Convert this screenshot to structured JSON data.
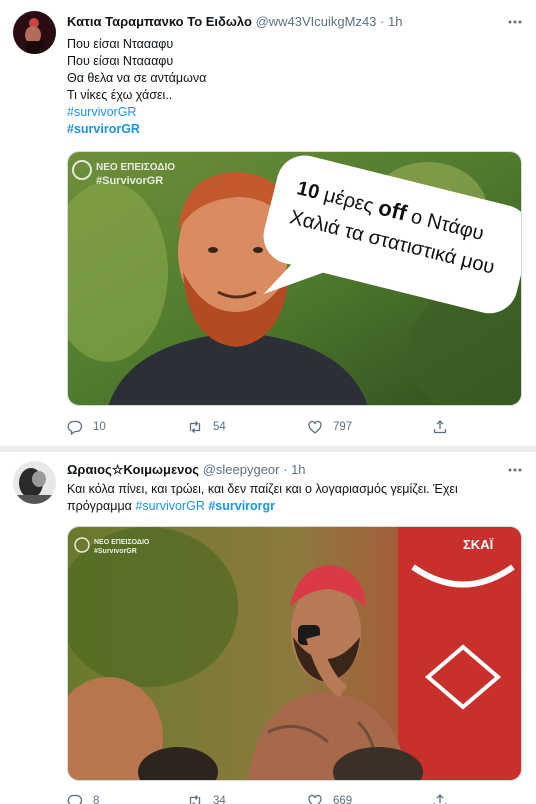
{
  "tweets": [
    {
      "author_name": "Κατια Ταραμπανκο Το Ειδωλο",
      "handle": "@ww43VIcuikgMz43",
      "separator": "·",
      "time": "1h",
      "lines": [
        "Που είσαι Νταααφυ",
        "Που είσαι Νταααφυ",
        "Θα θελα να σε αντάμωνα",
        "Τι νίκες έχω χάσει.."
      ],
      "hashtag": "#survivorGR",
      "hashtag_bold": "#survirorGR",
      "media": {
        "overlay_line1": "ΝΕΟ ΕΠΕΙΣΟΔΙΟ",
        "overlay_line2": "#SurvivorGR",
        "bubble_number": "10",
        "bubble_words": "μέρες",
        "bubble_off": "off",
        "bubble_rest": "ο Ντάφυ",
        "bubble_line2": "Χαλιά τα στατιστικά μου"
      },
      "replies": "10",
      "retweets": "54",
      "likes": "797"
    },
    {
      "author_name": "Ωραιος☆Κοιμωμενος",
      "handle": "@sleepygeor",
      "separator": "·",
      "time": "1h",
      "text_line1": "Και κόλα πίνει, και τρώει, και δεν παίζει και ο λογαριασμός γεμίζει. Έχει",
      "text_line2_prefix": "πρόγραμμα",
      "hashtag": "#survivorGR",
      "hashtag_bold": "#survirorgr",
      "media": {
        "overlay_line1": "ΝΕΟ ΕΠΕΙΣΟΔΙΟ",
        "overlay_line2": "#SurvivorGR",
        "channel_logo": "ΣΚΑΪ"
      },
      "replies": "8",
      "retweets": "34",
      "likes": "669"
    }
  ],
  "colors": {
    "link": "#1b95e0",
    "muted": "#5b7083",
    "divider": "#ebeef0"
  },
  "icons": [
    "reply-icon",
    "retweet-icon",
    "like-icon",
    "share-icon",
    "more-icon"
  ]
}
